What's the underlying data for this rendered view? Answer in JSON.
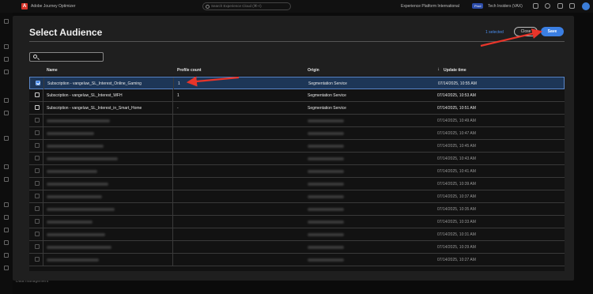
{
  "topbar": {
    "app_name": "Adobe Journey Optimizer",
    "search_placeholder": "Search Experience Cloud (⌘+/)",
    "org": "Experience Platform International",
    "env_badge": "Prod",
    "sandbox": "Tech Insiders (VAX)"
  },
  "background": {
    "footer_text": "Data management"
  },
  "modal": {
    "title": "Select Audience",
    "selected_count": "1 selected",
    "close_label": "Close",
    "save_label": "Save",
    "table": {
      "headers": {
        "name": "Name",
        "profile_count": "Profile count",
        "origin": "Origin",
        "update_time": "Update time"
      },
      "sort_icon": "arrow-down-icon",
      "rows": [
        {
          "name": "Subscription - vangeluw_SL_Interest_Online_Gaming",
          "profile_count": "1",
          "origin": "Segmentation Service",
          "update_time": "07/14/2025, 10:55 AM",
          "selected": true
        },
        {
          "name": "Subscription - vangeluw_SL_Interest_WFH",
          "profile_count": "1",
          "origin": "Segmentation Service",
          "update_time": "07/14/2025, 10:53 AM",
          "selected": false
        },
        {
          "name": "Subscription - vangeluw_SL_Interest_in_Smart_Home",
          "profile_count": "-",
          "origin": "Segmentation Service",
          "update_time": "07/14/2025, 10:51 AM",
          "selected": false
        }
      ],
      "blurred_update_times": [
        "07/14/2025, 10:49 AM",
        "07/14/2025, 10:47 AM",
        "07/14/2025, 10:45 AM",
        "07/14/2025, 10:43 AM",
        "07/14/2025, 10:41 AM",
        "07/14/2025, 10:39 AM",
        "07/14/2025, 10:37 AM",
        "07/14/2025, 10:35 AM",
        "07/14/2025, 10:33 AM",
        "07/14/2025, 10:31 AM",
        "07/14/2025, 10:29 AM",
        "07/14/2025, 10:27 AM"
      ]
    }
  },
  "colors": {
    "accent": "#3b7fe3",
    "annotation": "#e8352a",
    "selected_row": "#1d3657"
  }
}
